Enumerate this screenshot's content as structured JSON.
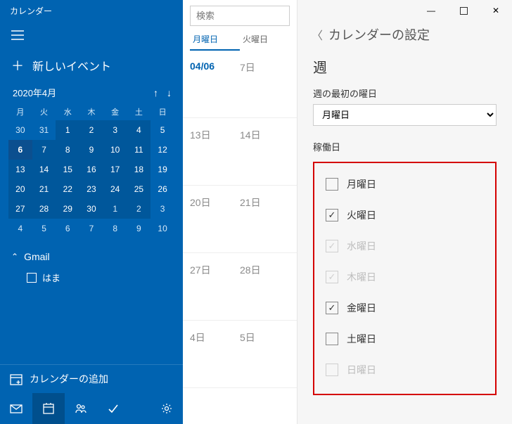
{
  "title": "カレンダー",
  "new_event": "新しいイベント",
  "month_label": "2020年4月",
  "dow": [
    "月",
    "火",
    "水",
    "木",
    "金",
    "土",
    "日"
  ],
  "weeks": [
    [
      {
        "n": "30"
      },
      {
        "n": "31"
      },
      {
        "n": "1",
        "c": true,
        "s": true
      },
      {
        "n": "2",
        "c": true,
        "s": true
      },
      {
        "n": "3",
        "c": true,
        "s": true
      },
      {
        "n": "4",
        "c": true,
        "s": true
      },
      {
        "n": "5",
        "c": true
      }
    ],
    [
      {
        "n": "6",
        "c": true,
        "sel": true
      },
      {
        "n": "7",
        "c": true,
        "s": true
      },
      {
        "n": "8",
        "c": true,
        "s": true
      },
      {
        "n": "9",
        "c": true,
        "s": true
      },
      {
        "n": "10",
        "c": true,
        "s": true
      },
      {
        "n": "11",
        "c": true,
        "s": true
      },
      {
        "n": "12",
        "c": true
      }
    ],
    [
      {
        "n": "13",
        "c": true,
        "s": true
      },
      {
        "n": "14",
        "c": true,
        "s": true
      },
      {
        "n": "15",
        "c": true,
        "s": true
      },
      {
        "n": "16",
        "c": true,
        "s": true
      },
      {
        "n": "17",
        "c": true,
        "s": true
      },
      {
        "n": "18",
        "c": true,
        "s": true
      },
      {
        "n": "19",
        "c": true
      }
    ],
    [
      {
        "n": "20",
        "c": true,
        "s": true
      },
      {
        "n": "21",
        "c": true,
        "s": true
      },
      {
        "n": "22",
        "c": true,
        "s": true
      },
      {
        "n": "23",
        "c": true,
        "s": true
      },
      {
        "n": "24",
        "c": true,
        "s": true
      },
      {
        "n": "25",
        "c": true,
        "s": true
      },
      {
        "n": "26",
        "c": true
      }
    ],
    [
      {
        "n": "27",
        "c": true,
        "s": true
      },
      {
        "n": "28",
        "c": true,
        "s": true
      },
      {
        "n": "29",
        "c": true,
        "s": true
      },
      {
        "n": "30",
        "c": true,
        "s": true
      },
      {
        "n": "1",
        "s": true
      },
      {
        "n": "2",
        "s": true
      },
      {
        "n": "3"
      }
    ],
    [
      {
        "n": "4"
      },
      {
        "n": "5"
      },
      {
        "n": "6"
      },
      {
        "n": "7"
      },
      {
        "n": "8"
      },
      {
        "n": "9"
      },
      {
        "n": "10"
      }
    ]
  ],
  "account": "Gmail",
  "sub_cal": "はま",
  "add_cal": "カレンダーの追加",
  "search_ph": "検索",
  "day_headers": [
    "月曜日",
    "火曜日"
  ],
  "grid_weeks": [
    [
      {
        "t": "04/06",
        "today": true
      },
      {
        "t": "7日"
      }
    ],
    [
      {
        "t": "13日"
      },
      {
        "t": "14日"
      }
    ],
    [
      {
        "t": "20日"
      },
      {
        "t": "21日"
      }
    ],
    [
      {
        "t": "27日"
      },
      {
        "t": "28日"
      }
    ],
    [
      {
        "t": "4日"
      },
      {
        "t": "5日"
      }
    ]
  ],
  "panel": {
    "title": "カレンダーの設定",
    "section_week": "週",
    "first_day_label": "週の最初の曜日",
    "first_day_value": "月曜日",
    "workday_label": "稼働日",
    "days": [
      {
        "label": "月曜日",
        "checked": false,
        "disabled": false
      },
      {
        "label": "火曜日",
        "checked": true,
        "disabled": false
      },
      {
        "label": "水曜日",
        "checked": true,
        "disabled": true
      },
      {
        "label": "木曜日",
        "checked": true,
        "disabled": true
      },
      {
        "label": "金曜日",
        "checked": true,
        "disabled": false
      },
      {
        "label": "土曜日",
        "checked": false,
        "disabled": false
      },
      {
        "label": "日曜日",
        "checked": false,
        "disabled": true
      }
    ]
  }
}
